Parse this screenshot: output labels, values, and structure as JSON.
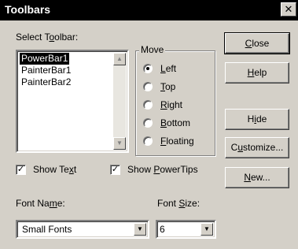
{
  "dialog": {
    "title": "Toolbars",
    "close_glyph": "✕"
  },
  "toolbar_list": {
    "label_pre": "Select T",
    "label_u": "o",
    "label_post": "olbar:",
    "items": [
      "PowerBar1",
      "PainterBar1",
      "PainterBar2"
    ],
    "selected": "PowerBar1"
  },
  "move_group": {
    "legend": "Move",
    "options": [
      {
        "u": "L",
        "rest": "eft",
        "checked": true
      },
      {
        "u": "T",
        "rest": "op",
        "checked": false
      },
      {
        "u": "R",
        "rest": "ight",
        "checked": false
      },
      {
        "u": "B",
        "rest": "ottom",
        "checked": false
      },
      {
        "u": "F",
        "rest": "loating",
        "checked": false
      }
    ]
  },
  "buttons": {
    "close": {
      "u": "C",
      "rest": "lose"
    },
    "help": {
      "u": "H",
      "rest": "elp"
    },
    "hide": {
      "pre": "H",
      "u": "i",
      "rest": "de"
    },
    "customize": {
      "pre": "C",
      "u": "u",
      "rest": "stomize..."
    },
    "new": {
      "u": "N",
      "rest": "ew..."
    }
  },
  "options": {
    "show_text": {
      "pre": "Show Te",
      "u": "x",
      "rest": "t",
      "checked": true
    },
    "show_powertips": {
      "pre": "Show ",
      "u": "P",
      "rest": "owerTips",
      "checked": true
    }
  },
  "font_name": {
    "label_pre": "Font Na",
    "label_u": "m",
    "label_post": "e:",
    "value": "Small Fonts"
  },
  "font_size": {
    "label_pre": "Font ",
    "label_u": "S",
    "label_post": "ize:",
    "value": "6"
  },
  "glyphs": {
    "check": "✓",
    "arrow_up": "▲",
    "arrow_down": "▼"
  }
}
